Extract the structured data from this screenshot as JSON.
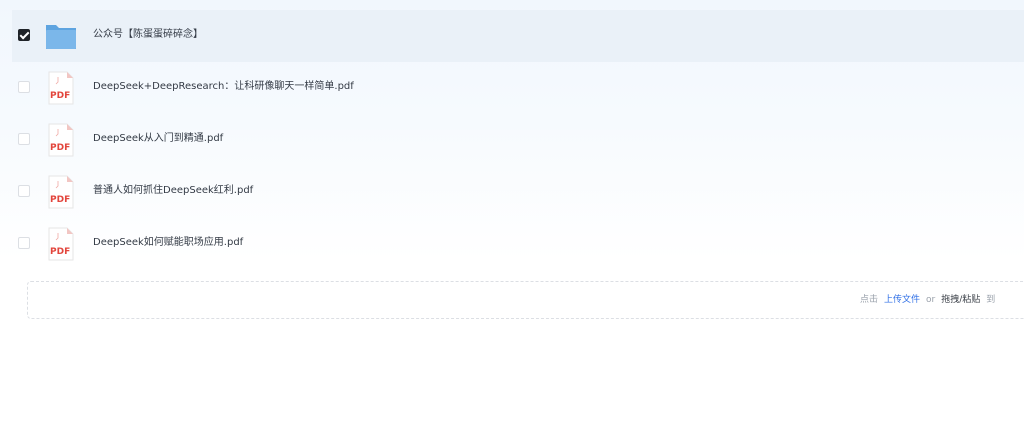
{
  "files": [
    {
      "name": "公众号【陈蛋蛋碎碎念】",
      "type": "folder",
      "checked": true
    },
    {
      "name": "DeepSeek+DeepResearch：让科研像聊天一样简单.pdf",
      "type": "pdf",
      "checked": false
    },
    {
      "name": "DeepSeek从入门到精通.pdf",
      "type": "pdf",
      "checked": false
    },
    {
      "name": "普通人如何抓住DeepSeek红利.pdf",
      "type": "pdf",
      "checked": false
    },
    {
      "name": "DeepSeek如何赋能职场应用.pdf",
      "type": "pdf",
      "checked": false
    }
  ],
  "pdf_icon_label": "PDF",
  "upload": {
    "prefix": "点击",
    "upload_link": "上传文件",
    "or": "or",
    "drag_paste": "拖拽/粘贴",
    "suffix": "到"
  },
  "colors": {
    "folder": "#6aaee6",
    "pdf_red": "#e2453c",
    "link": "#2f6fe6",
    "selected_row": "#eaf1f8"
  }
}
